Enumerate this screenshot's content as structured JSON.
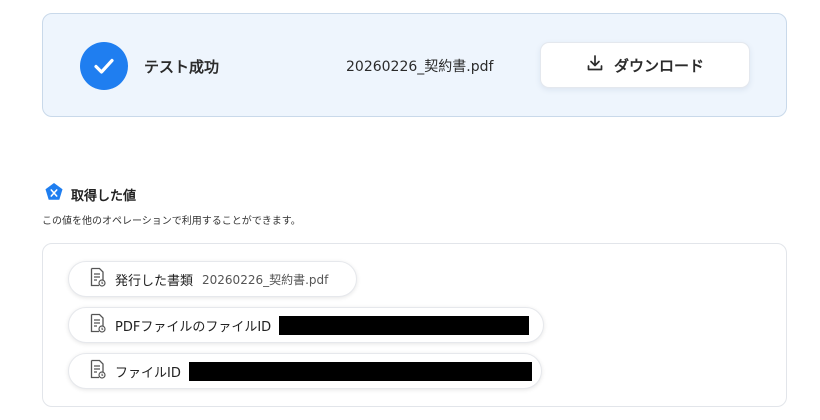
{
  "result": {
    "status": "テスト成功",
    "file_name": "20260226_契約書.pdf",
    "download_label": "ダウンロード"
  },
  "section": {
    "title": "取得した値",
    "description": "この値を他のオペレーションで利用することができます。"
  },
  "values": [
    {
      "label": "発行した書類",
      "value": "20260226_契約書.pdf",
      "redacted": false
    },
    {
      "label": "PDFファイルのファイルID",
      "value": "",
      "redacted": true
    },
    {
      "label": "ファイルID",
      "value": "",
      "redacted": true
    }
  ],
  "colors": {
    "accent": "#1f7ef0",
    "card_background": "#eef5fd",
    "card_border": "#c9d9ea"
  },
  "icons": {
    "status": "check-icon",
    "download": "download-icon",
    "section": "hexagon-x-icon",
    "value": "document-icon"
  }
}
